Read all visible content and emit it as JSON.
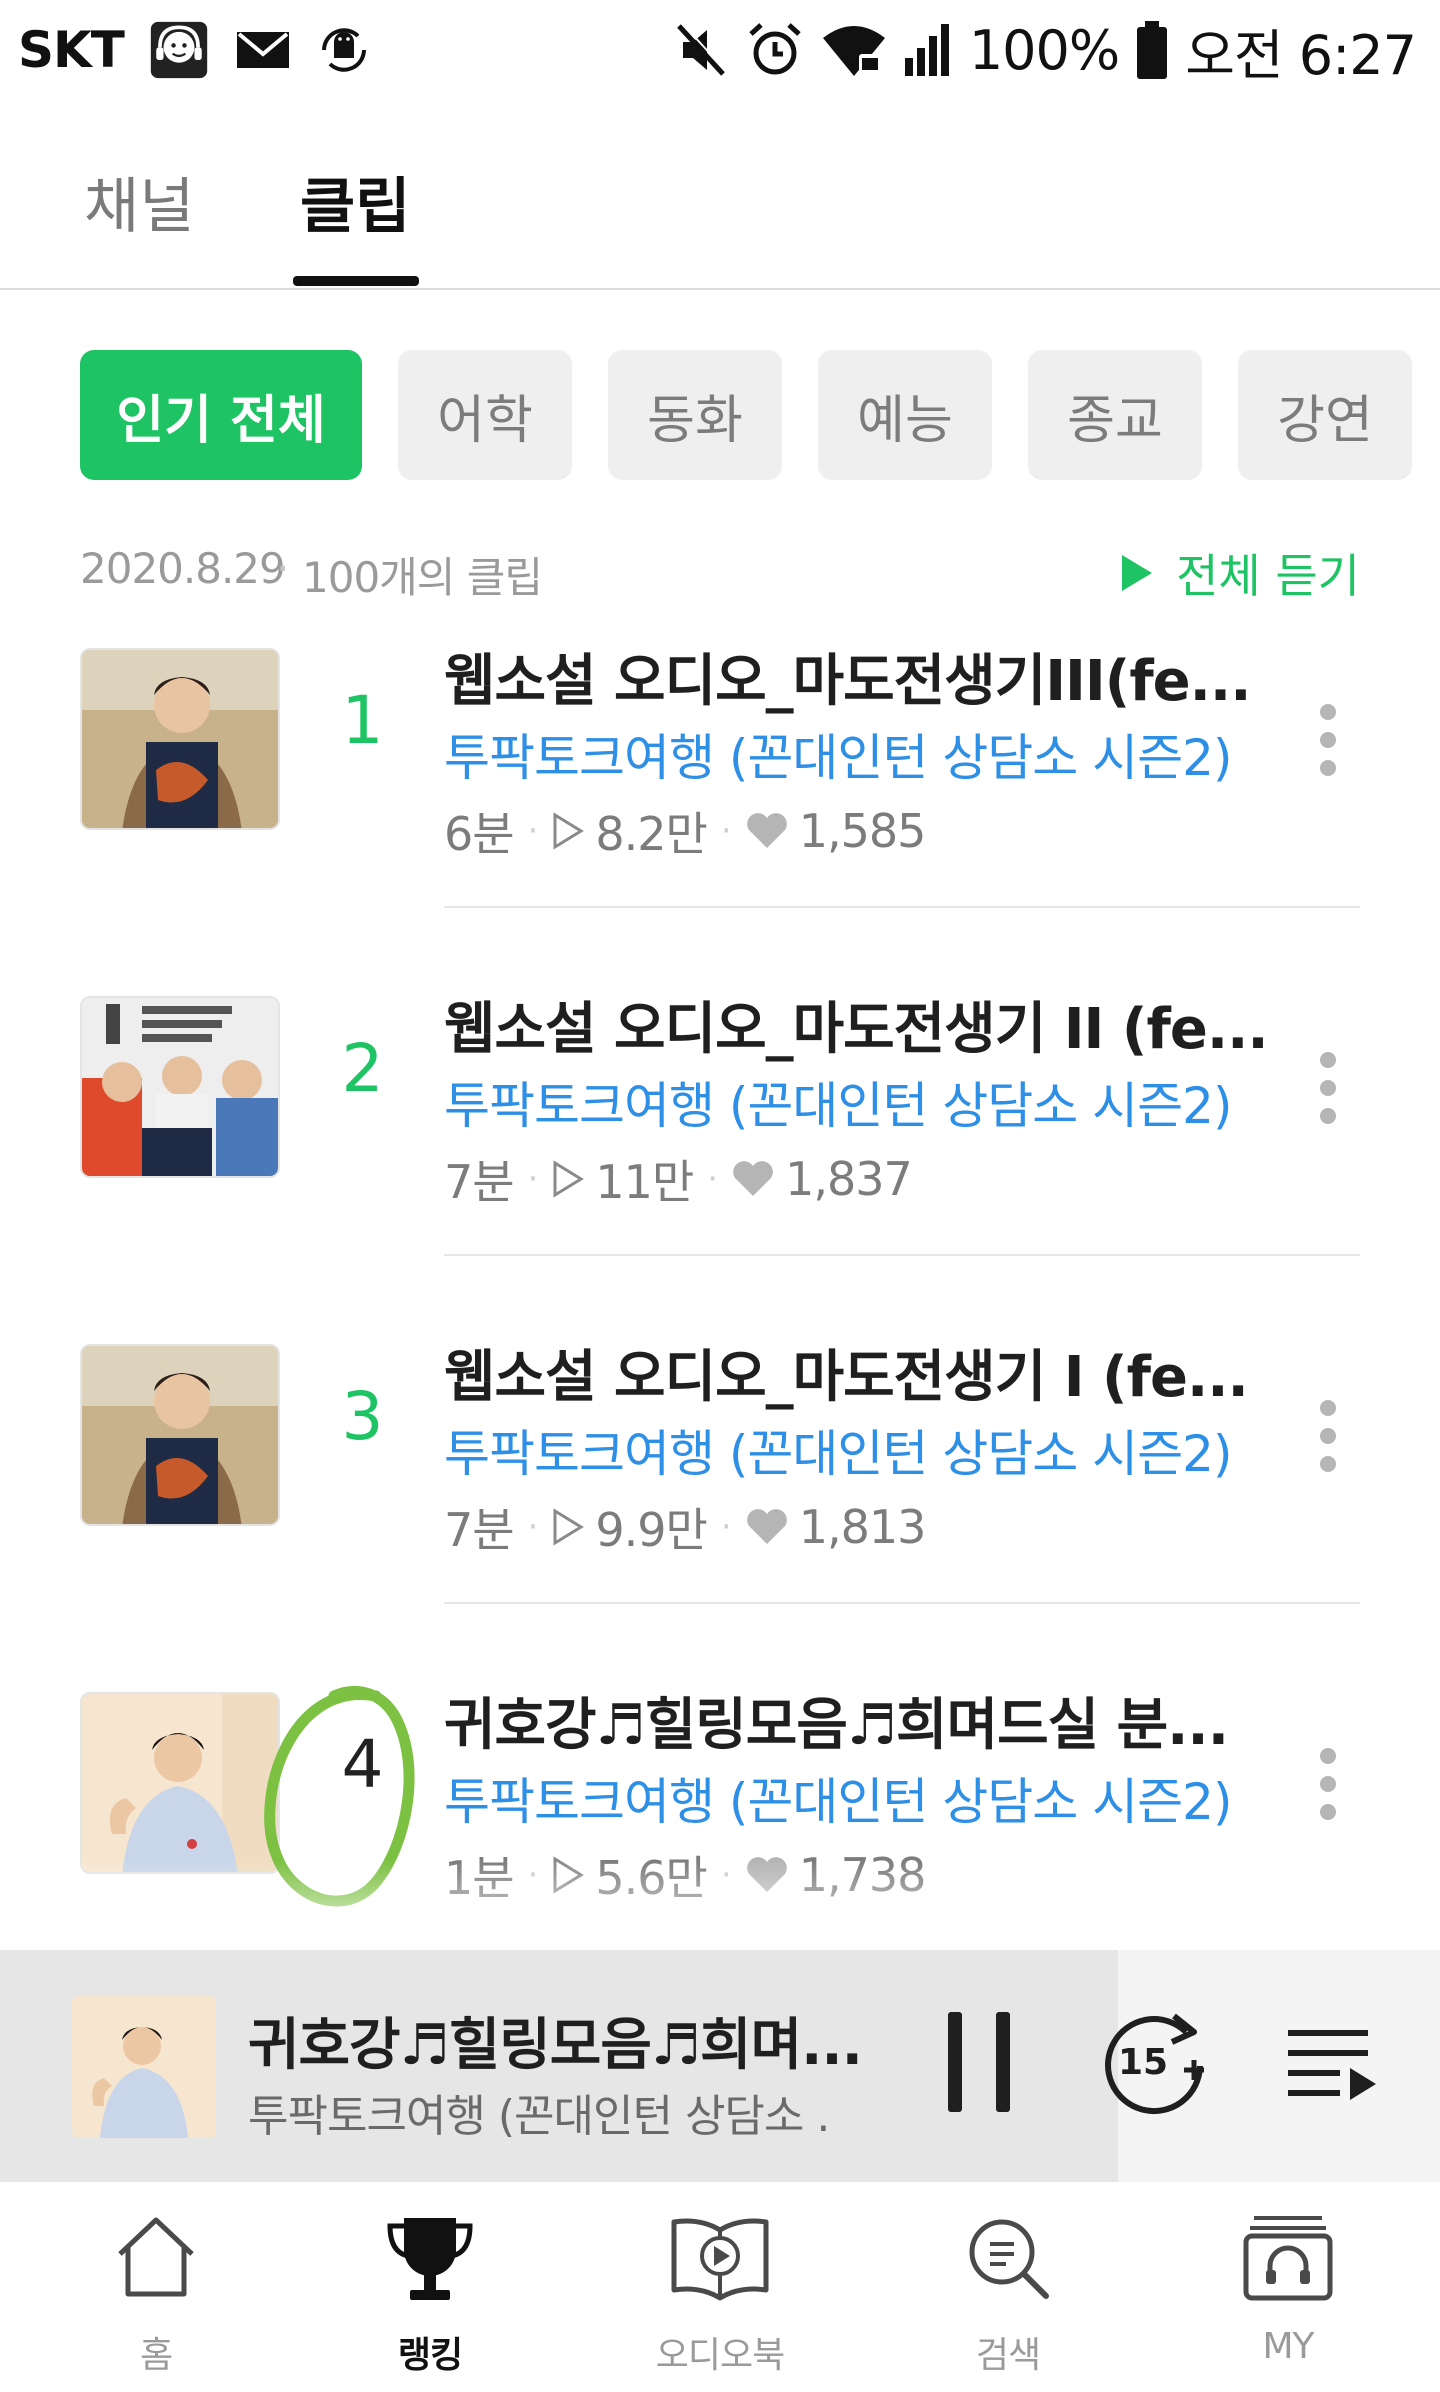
{
  "status_bar": {
    "carrier": "SKT",
    "battery": "100%",
    "time": "오전 6:27"
  },
  "top_tabs": [
    {
      "label": "채널",
      "active": false
    },
    {
      "label": "클립",
      "active": true
    }
  ],
  "categories": [
    {
      "label": "인기 전체",
      "active": true
    },
    {
      "label": "어학",
      "active": false
    },
    {
      "label": "동화",
      "active": false
    },
    {
      "label": "예능",
      "active": false
    },
    {
      "label": "종교",
      "active": false
    },
    {
      "label": "강연",
      "active": false
    }
  ],
  "info": {
    "date": "2020.8.29",
    "separator": "·",
    "count": "100개의 클립",
    "play_all": "전체 듣기"
  },
  "clips": [
    {
      "rank": "1",
      "title": "웹소설 오디오_마도전생기III(fe...",
      "channel": "투팍토크여행 (꼰대인턴 상담소 시즌2)",
      "duration": "6분",
      "plays": "8.2만",
      "likes": "1,585"
    },
    {
      "rank": "2",
      "title": "웹소설 오디오_마도전생기 II (fe...",
      "channel": "투팍토크여행 (꼰대인턴 상담소 시즌2)",
      "duration": "7분",
      "plays": "11만",
      "likes": "1,837"
    },
    {
      "rank": "3",
      "title": "웹소설 오디오_마도전생기 I (fe...",
      "channel": "투팍토크여행 (꼰대인턴 상담소 시즌2)",
      "duration": "7분",
      "plays": "9.9만",
      "likes": "1,813"
    },
    {
      "rank": "4",
      "title": "귀호강♬힐링모음♬희며드실 분...",
      "channel": "투팍토크여행 (꼰대인턴 상담소 시즌2)",
      "duration": "1분",
      "plays": "5.6만",
      "likes": "1,738"
    }
  ],
  "player": {
    "title": "귀호강♬힐링모음♬희며...",
    "subtitle": "투팍토크여행 (꼰대인턴 상담소 ...",
    "skip_label": "15"
  },
  "bottom_nav": [
    {
      "label": "홈",
      "icon": "home-icon",
      "active": false
    },
    {
      "label": "랭킹",
      "icon": "trophy-icon",
      "active": true
    },
    {
      "label": "오디오북",
      "icon": "audiobook-icon",
      "active": false
    },
    {
      "label": "검색",
      "icon": "search-icon",
      "active": false
    },
    {
      "label": "MY",
      "icon": "my-library-icon",
      "active": false
    }
  ],
  "colors": {
    "accent_green": "#1ec363",
    "channel_blue": "#2e8fe6",
    "annotation_circle": "#7cc142"
  }
}
